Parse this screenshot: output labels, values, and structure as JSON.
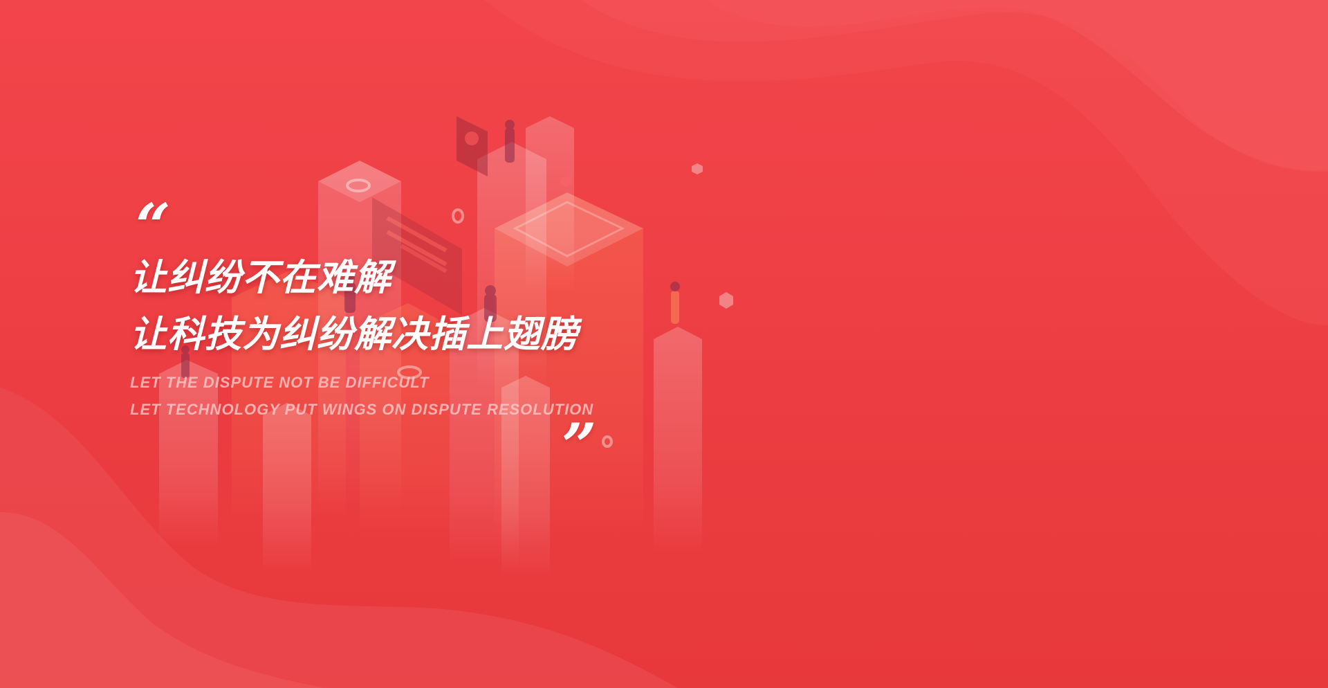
{
  "slogan": {
    "open_quote": "“",
    "close_quote": "”",
    "cn_line_1": "让纠纷不在难解",
    "cn_line_2": "让科技为纠纷解决插上翅膀",
    "en_line_1": "LET THE DISPUTE NOT BE DIFFICULT",
    "en_line_2": "LET TECHNOLOGY PUT WINGS ON DISPUTE RESOLUTION"
  },
  "colors": {
    "background": "#ee3f43",
    "text_primary": "#ffffff",
    "text_secondary": "#ffcdcd"
  }
}
